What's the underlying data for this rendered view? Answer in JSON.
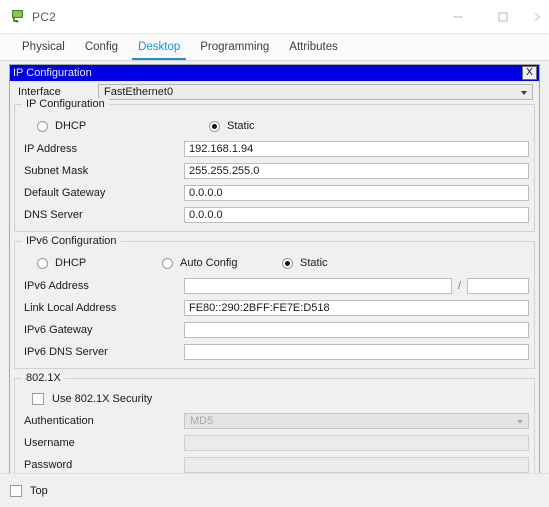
{
  "window": {
    "title": "PC2",
    "icon": "packet-tracer-pc-icon",
    "controls": {
      "minimize": "–",
      "maximize": "□",
      "close": "›"
    }
  },
  "tabs": [
    {
      "label": "Physical",
      "active": false
    },
    {
      "label": "Config",
      "active": false
    },
    {
      "label": "Desktop",
      "active": true
    },
    {
      "label": "Programming",
      "active": false
    },
    {
      "label": "Attributes",
      "active": false
    }
  ],
  "dialog": {
    "title": "IP Configuration",
    "close_label": "X",
    "accent_blue": "#0000e4",
    "active_tab_blue": "#1c90d4"
  },
  "interface": {
    "label": "Interface",
    "value": "FastEthernet0"
  },
  "ipv4": {
    "legend": "IP Configuration",
    "modes": [
      {
        "label": "DHCP",
        "selected": false
      },
      {
        "label": "Static",
        "selected": true
      }
    ],
    "fields": [
      {
        "label": "IP Address",
        "value": "192.168.1.94",
        "disabled": false
      },
      {
        "label": "Subnet Mask",
        "value": "255.255.255.0",
        "disabled": false
      },
      {
        "label": "Default Gateway",
        "value": "0.0.0.0",
        "disabled": false
      },
      {
        "label": "DNS Server",
        "value": "0.0.0.0",
        "disabled": false
      }
    ]
  },
  "ipv6": {
    "legend": "IPv6 Configuration",
    "modes": [
      {
        "label": "DHCP",
        "selected": false
      },
      {
        "label": "Auto Config",
        "selected": false
      },
      {
        "label": "Static",
        "selected": true
      }
    ],
    "address_row": {
      "label": "IPv6 Address",
      "value": "",
      "separator": "/",
      "prefix": ""
    },
    "fields": [
      {
        "label": "Link Local Address",
        "value": "FE80::290:2BFF:FE7E:D518",
        "disabled": false
      },
      {
        "label": "IPv6 Gateway",
        "value": "",
        "disabled": false
      },
      {
        "label": "IPv6 DNS Server",
        "value": "",
        "disabled": false
      }
    ]
  },
  "dot1x": {
    "legend": "802.1X",
    "use_security": {
      "label": "Use 802.1X Security",
      "checked": false
    },
    "fields": [
      {
        "label": "Authentication",
        "value": "MD5",
        "disabled": true,
        "type": "combo"
      },
      {
        "label": "Username",
        "value": "",
        "disabled": true,
        "type": "text"
      },
      {
        "label": "Password",
        "value": "",
        "disabled": true,
        "type": "text"
      }
    ]
  },
  "bottom": {
    "top_checkbox": {
      "label": "Top",
      "checked": false
    }
  }
}
